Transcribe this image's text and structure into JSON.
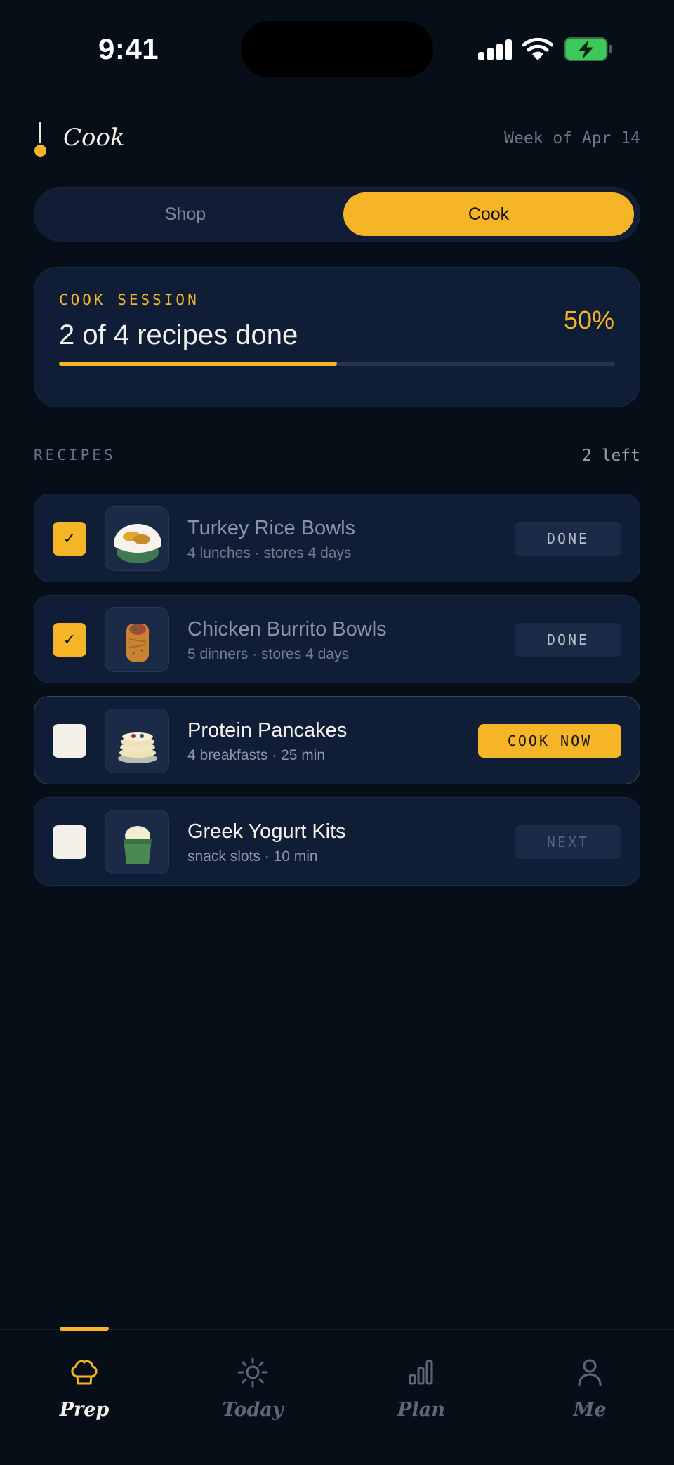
{
  "status_bar": {
    "time": "9:41"
  },
  "header": {
    "title": "Cook",
    "week": "Week of Apr 14"
  },
  "segmented": {
    "shop_label": "Shop",
    "cook_label": "Cook",
    "selected": "Cook"
  },
  "session": {
    "label": "COOK SESSION",
    "title": "2 of 4 recipes done",
    "percent_label": "50%",
    "progress": 0.5
  },
  "recipes_section": {
    "label": "RECIPES",
    "count": "2 left"
  },
  "recipes": [
    {
      "title": "Turkey Rice Bowls",
      "subtitle": "4 lunches · stores 4 days",
      "checked": true,
      "action": "DONE",
      "icon": "rice-bowl-icon"
    },
    {
      "title": "Chicken Burrito Bowls",
      "subtitle": "5 dinners · stores 4 days",
      "checked": true,
      "action": "DONE",
      "icon": "burrito-icon"
    },
    {
      "title": "Protein Pancakes",
      "subtitle": "4 breakfasts · 25 min",
      "checked": false,
      "action": "COOK NOW",
      "icon": "pancakes-icon"
    },
    {
      "title": "Greek Yogurt Kits",
      "subtitle": "snack slots · 10 min",
      "checked": false,
      "action": "NEXT",
      "icon": "yogurt-cup-icon"
    }
  ],
  "tabbar": {
    "tabs": [
      {
        "label": "Prep",
        "icon": "chef-hat-icon",
        "active": true
      },
      {
        "label": "Today",
        "icon": "sun-icon",
        "active": false
      },
      {
        "label": "Plan",
        "icon": "bar-chart-icon",
        "active": false
      },
      {
        "label": "Me",
        "icon": "person-icon",
        "active": false
      }
    ]
  },
  "colors": {
    "accent": "#f5b526",
    "background": "#060e17",
    "card": "#101d36",
    "battery": "#3fc85a"
  }
}
